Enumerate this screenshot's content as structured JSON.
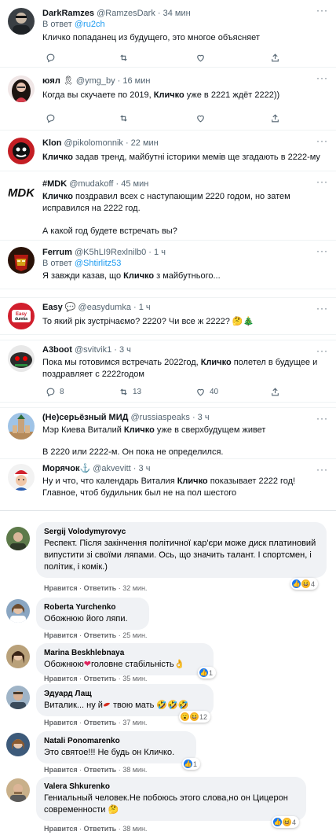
{
  "tweets": [
    {
      "name": "DarkRamzes",
      "handle": "@RamzesDark",
      "time": "34 мин",
      "reply_prefix": "В ответ",
      "reply_to": "@ru2ch",
      "text": "Кличко попаданец из будущего, это многое объясняет",
      "more": "···",
      "actions": {
        "reply": "",
        "retweet": "",
        "like": ""
      }
    },
    {
      "name": "юял",
      "badge": "🎗",
      "handle": "@ymg_by",
      "time": "16 мин",
      "text_a": "Когда вы скучаете по 2019, ",
      "text_bold": "Кличко",
      "text_b": " уже в 2221 ждёт 2222))",
      "more": "···"
    },
    {
      "name": "Klon",
      "handle": "@pikolomonnik",
      "time": "22 мин",
      "text_bold": "Кличко",
      "text_b": " задав тренд, майбутні історики мемів ще згадають в 2222-му",
      "more": "···"
    },
    {
      "name": "#MDK",
      "handle": "@mudakoff",
      "time": "45 мин",
      "text_bold": "Кличко",
      "text_b": " поздравил всех с наступающим 2220 годом, но затем исправился на 2222 год.",
      "text_c": "А какой год будете встречать вы?",
      "more": "···"
    },
    {
      "name": "Ferrum",
      "handle": "@K5hLI9Rexlnilb0",
      "time": "1 ч",
      "reply_prefix": "В ответ",
      "reply_to": "@Shtirlitz53",
      "text_a": "Я завжди казав, що ",
      "text_bold": "Кличко",
      "text_b": " з майбутнього...",
      "more": "···"
    },
    {
      "name": "Easy",
      "badge": "💬",
      "handle": "@easydumka",
      "time": "1 ч",
      "text": "То який рік зустрічаємо? 2220? Чи все ж 2222? 🤔🎄",
      "more": "···"
    },
    {
      "name": "A3boot",
      "handle": "@svitvik1",
      "time": "3 ч",
      "text_a": "Пока мы готовимся встречать 2022год, ",
      "text_bold": "Кличко",
      "text_b": " полетел в будущее и поздравляет с 2222годом",
      "more": "···",
      "actions": {
        "reply": "8",
        "retweet": "13",
        "like": "40"
      }
    },
    {
      "name": "(Не)серьёзный МИД",
      "handle": "@russiaspeaks",
      "time": "3 ч",
      "text_a": "Мэр Киева Виталий ",
      "text_bold": "Кличко",
      "text_b": " уже в сверхбудущем живет",
      "text_c": "В 2220 или 2222-м. Он пока не определился.",
      "more": "···"
    },
    {
      "name": "Морячок",
      "badge": "⚓",
      "handle": "@akvevitt",
      "time": "3 ч",
      "text_a": "Ну и что, что календарь Виталия ",
      "text_bold": "Кличко",
      "text_b": " показывает 2222 год! Главное, чтоб будильник был не на пол шестого",
      "more": "···"
    }
  ],
  "comments": [
    {
      "name": "Sergij Volodymyrovyc",
      "text": "Респект. Після закінчення політичної кар'єри може диск платиновий випустити зі своїми ляпами. Ось, що значить талант. І спортсмен, і політик, і комік.)",
      "like": "Нравится",
      "reply": "Ответить",
      "time": "32 мин.",
      "count": "4"
    },
    {
      "name": "Roberta Yurchenko",
      "text": "Обожнюю його ляпи.",
      "like": "Нравится",
      "reply": "Ответить",
      "time": "25 мин."
    },
    {
      "name": "Marina Beskhlebnaya",
      "text_a": "Обожнюю",
      "text_b": "головне стабільність",
      "emoji": "👌",
      "like": "Нравится",
      "reply": "Ответить",
      "time": "35 мин.",
      "count": "1"
    },
    {
      "name": "Эдуард Лащ",
      "text_a": "Виталик... ну й",
      "text_b": " твою мать",
      "emoji": "🤣🤣🤣",
      "like": "Нравится",
      "reply": "Ответить",
      "time": "37 мин.",
      "count": "12"
    },
    {
      "name": "Natali Ponomarenko",
      "text": "Это святое!!! Не будь он Кличко.",
      "like": "Нравится",
      "reply": "Ответить",
      "time": "38 мин.",
      "count": "1"
    },
    {
      "name": "Valera Shkurenko",
      "text": "Гениальный человек.Не побоюсь этого слова,но он Цицерон современности",
      "emoji": "🤔",
      "like": "Нравится",
      "reply": "Ответить",
      "time": "38 мин.",
      "count": "4"
    }
  ],
  "colors": {
    "link": "#1d9bf0",
    "muted": "#536471",
    "bubble": "#f0f2f5",
    "fb_like": "#1877f2"
  },
  "icons": [
    "reply-icon",
    "retweet-icon",
    "like-icon",
    "share-icon",
    "more-icon"
  ]
}
